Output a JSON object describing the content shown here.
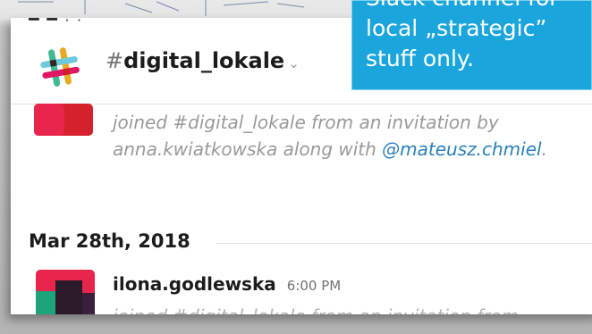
{
  "top_cut_text": "▀ ▀ · ·",
  "callout": {
    "line1": "Slack channel for",
    "line2": "local „strategic”",
    "line3": "stuff only."
  },
  "channel": {
    "hash": "#",
    "name": "digital_lokale",
    "chevron": "⌄"
  },
  "join_message": {
    "text_before": "joined #digital_lokale from an invitation by anna.kwiatkowska along with ",
    "mention": "@mateusz.chmiel",
    "text_after": "."
  },
  "date_divider": "Mar 28th, 2018",
  "message": {
    "user": "ilona.godlewska",
    "time": "6:00 PM",
    "cut_text": "joined #digital_lokale from an invitation from"
  },
  "colors": {
    "callout_bg": "#1aa6dc",
    "mention": "#2a80b9",
    "muted": "#9a9a9a"
  }
}
